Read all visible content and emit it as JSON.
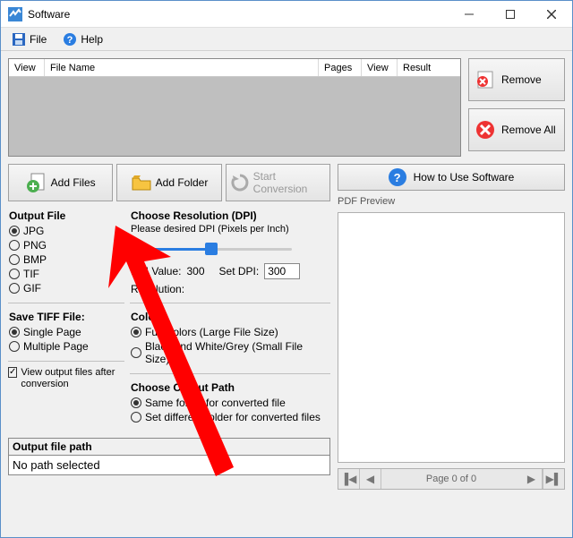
{
  "window": {
    "title": "Software"
  },
  "menu": {
    "file": "File",
    "help": "Help"
  },
  "list": {
    "cols": [
      "View",
      "File Name",
      "Pages",
      "View",
      "Result"
    ]
  },
  "side": {
    "remove": "Remove",
    "remove_all": "Remove All"
  },
  "actions": {
    "add_files": "Add Files",
    "add_folder": "Add Folder",
    "start": "Start Conversion"
  },
  "help_btn": "How to Use Software",
  "output_file": {
    "title": "Output File",
    "options": [
      "JPG",
      "PNG",
      "BMP",
      "TIF",
      "GIF"
    ],
    "selected": "JPG"
  },
  "resolution": {
    "title": "Choose Resolution (DPI)",
    "hint": "Please desired DPI (Pixels per Inch)",
    "dpi_label": "DPI Value:",
    "dpi_value": "300",
    "set_label": "Set DPI:",
    "set_value": "300",
    "res_label": "Resolution:"
  },
  "tiff": {
    "title": "Save TIFF File:",
    "options": [
      "Single Page",
      "Multiple Page"
    ],
    "selected": "Single Page"
  },
  "colors": {
    "title": "Colors",
    "options": [
      "Full Colors (Large File Size)",
      "Black and White/Grey (Small File Size)"
    ],
    "selected": "Full Colors (Large File Size)"
  },
  "output_path": {
    "title": "Choose Output Path",
    "options": [
      "Same folder for converted file",
      "Set different folder for converted files"
    ],
    "selected": "Same folder for converted file"
  },
  "view_after": {
    "label": "View output files after conversion",
    "checked": true
  },
  "outpath": {
    "title": "Output file path",
    "value": "No path selected"
  },
  "preview": {
    "label": "PDF Preview",
    "page_text": "Page 0 of 0"
  }
}
